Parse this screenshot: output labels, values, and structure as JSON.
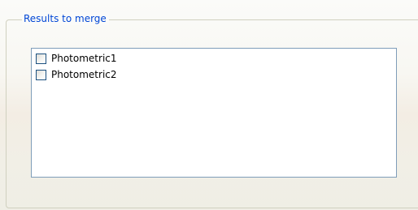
{
  "groupbox": {
    "title": "Results to merge"
  },
  "results_list": {
    "items": [
      {
        "label": "Photometric1",
        "checked": false
      },
      {
        "label": "Photometric2",
        "checked": false
      }
    ]
  },
  "colors": {
    "group_title": "#0046d5",
    "group_border": "#d0d0bf",
    "list_border": "#7f9db9",
    "checkbox_border": "#1c5180"
  }
}
